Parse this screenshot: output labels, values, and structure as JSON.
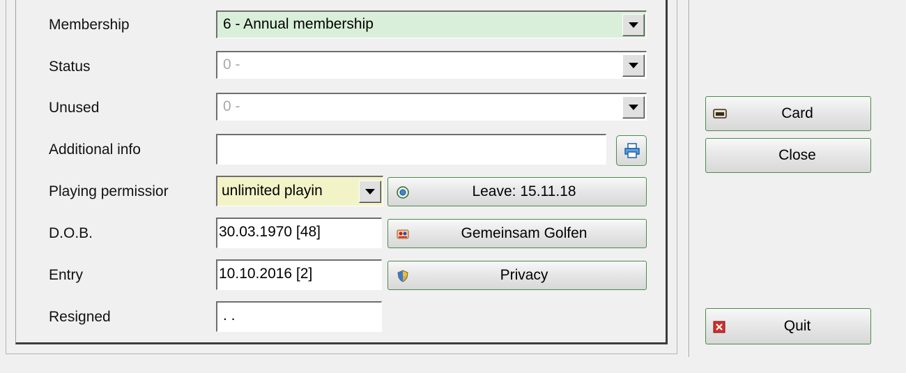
{
  "form": {
    "membership": {
      "label": "Membership",
      "value": "6 - Annual membership",
      "bg": "#d9efd9"
    },
    "status": {
      "label": "Status",
      "value": "0 -"
    },
    "unused": {
      "label": "Unused",
      "value": "0 -"
    },
    "additional_info": {
      "label": "Additional info",
      "value": ""
    },
    "playing_permission": {
      "label": "Playing permissior",
      "value": "unlimited playin",
      "bg": "#f3f3c8"
    },
    "dob": {
      "label": "D.O.B.",
      "value": "30.03.1970  [48]"
    },
    "entry": {
      "label": "Entry",
      "value": "10.10.2016  [2]"
    },
    "resigned": {
      "label": "Resigned",
      "value": " .  ."
    }
  },
  "buttons": {
    "leave": {
      "label": "Leave: 15.11.18",
      "icon": "leave-icon"
    },
    "gemeinsam": {
      "label": "Gemeinsam Golfen",
      "icon": "golf-group-icon"
    },
    "privacy": {
      "label": "Privacy",
      "icon": "shield-icon"
    },
    "card": {
      "label": "Card",
      "icon": "id-card-icon"
    },
    "close": {
      "label": "Close"
    },
    "quit": {
      "label": "Quit",
      "icon": "quit-icon"
    }
  },
  "colors": {
    "button_border": "#4a8a4a",
    "quit_icon": "#d0302c"
  }
}
